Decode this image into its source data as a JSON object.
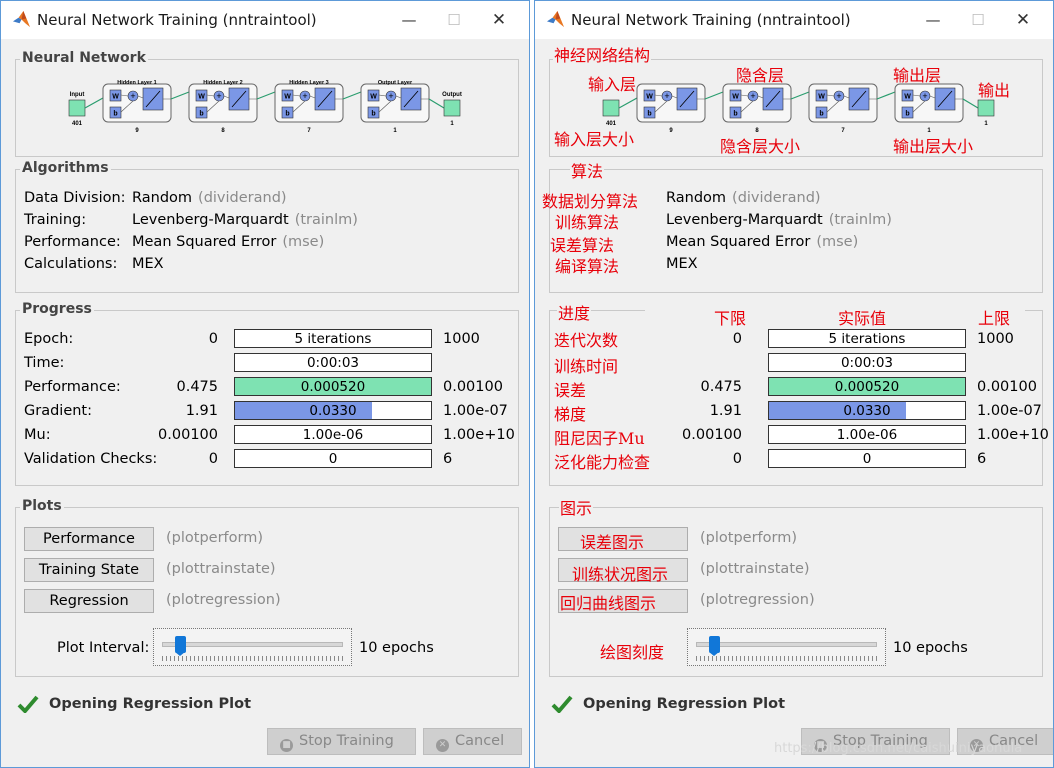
{
  "window_title": "Neural Network Training (nntraintool)",
  "network": {
    "title": "Neural Network",
    "input_label": "Input",
    "input_size": "401",
    "output_label": "Output",
    "output_size": "1",
    "layers": [
      {
        "name": "Hidden Layer 1",
        "size": "9"
      },
      {
        "name": "Hidden Layer 2",
        "size": "8"
      },
      {
        "name": "Hidden Layer 3",
        "size": "7"
      },
      {
        "name": "Output Layer",
        "size": "1"
      }
    ]
  },
  "algorithms": {
    "title": "Algorithms",
    "rows": [
      {
        "label": "Data Division:",
        "value": "Random",
        "fn": "(dividerand)"
      },
      {
        "label": "Training:",
        "value": "Levenberg-Marquardt",
        "fn": "(trainlm)"
      },
      {
        "label": "Performance:",
        "value": "Mean Squared Error",
        "fn": "(mse)"
      },
      {
        "label": "Calculations:",
        "value": "MEX",
        "fn": ""
      }
    ]
  },
  "progress": {
    "title": "Progress",
    "rows": [
      {
        "label": "Epoch:",
        "start": "0",
        "current": "5 iterations",
        "end": "1000",
        "fill": 0.0,
        "fill_color": "#ffffff"
      },
      {
        "label": "Time:",
        "start": "",
        "current": "0:00:03",
        "end": "",
        "fill": 0.0,
        "fill_color": "#ffffff"
      },
      {
        "label": "Performance:",
        "start": "0.475",
        "current": "0.000520",
        "end": "0.00100",
        "fill": 1.0,
        "fill_color": "#7ee2b2"
      },
      {
        "label": "Gradient:",
        "start": "1.91",
        "current": "0.0330",
        "end": "1.00e-07",
        "fill": 0.7,
        "fill_color": "#7b97e6"
      },
      {
        "label": "Mu:",
        "start": "0.00100",
        "current": "1.00e-06",
        "end": "1.00e+10",
        "fill": 0.0,
        "fill_color": "#ffffff"
      },
      {
        "label": "Validation Checks:",
        "start": "0",
        "current": "0",
        "end": "6",
        "fill": 0.0,
        "fill_color": "#ffffff"
      }
    ]
  },
  "plots": {
    "title": "Plots",
    "buttons": [
      {
        "label": "Performance",
        "fn": "(plotperform)"
      },
      {
        "label": "Training State",
        "fn": "(plottrainstate)"
      },
      {
        "label": "Regression",
        "fn": "(plotregression)"
      }
    ],
    "interval_label": "Plot Interval:",
    "interval_value": "10 epochs",
    "slider_position": 0.1
  },
  "status_text": "Opening Regression Plot",
  "buttons": {
    "stop": "Stop Training",
    "cancel": "Cancel"
  },
  "annotations": {
    "network_structure": "神经网络结构",
    "input_layer": "输入层",
    "hidden_layer": "隐含层",
    "output_layer": "输出层",
    "output": "输出",
    "input_size": "输入层大小",
    "hidden_size": "隐含层大小",
    "output_size": "输出层大小",
    "algorithms": "算法",
    "data_division": "数据划分算法",
    "training": "训练算法",
    "performance": "误差算法",
    "calculations": "编译算法",
    "progress": "进度",
    "lower_limit": "下限",
    "actual_value": "实际值",
    "upper_limit": "上限",
    "epoch": "迭代次数",
    "time": "训练时间",
    "perf": "误差",
    "gradient": "梯度",
    "mu": "阻尼因子Mu",
    "validation": "泛化能力检查",
    "plots": "图示",
    "plot_perf": "误差图示",
    "plot_train": "训练状况图示",
    "plot_reg": "回归曲线图示",
    "interval": "绘图刻度"
  },
  "watermark": "https://blog.csdn.net/caishuiniyaonula",
  "colors": {
    "window_border": "#5d9ad8",
    "annotation": "#e8000a",
    "performance_fill": "#7ee2b2",
    "gradient_fill": "#7b97e6",
    "slider_thumb": "#1177d8"
  }
}
